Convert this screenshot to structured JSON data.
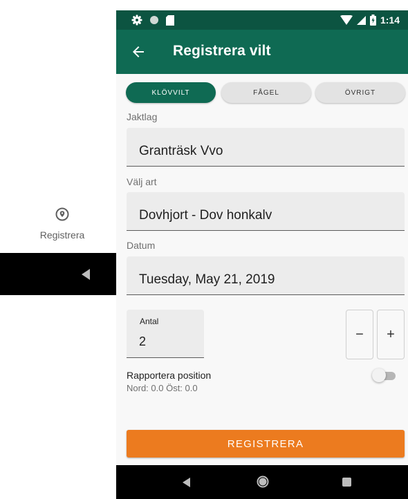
{
  "background_app": {
    "nav_label": "Registrera",
    "nav_icon": "location-pin-icon"
  },
  "status_bar": {
    "time": "1:14",
    "icons_left": [
      "settings-icon",
      "circle-icon",
      "sd-card-icon"
    ],
    "icons_right": [
      "wifi-icon",
      "signal-icon",
      "battery-icon"
    ]
  },
  "app_bar": {
    "title": "Registrera vilt",
    "back_icon": "arrow-left-icon"
  },
  "segments": [
    {
      "label": "KLÖVVILT",
      "active": true
    },
    {
      "label": "FÅGEL",
      "active": false
    },
    {
      "label": "ÖVRIGT",
      "active": false
    }
  ],
  "fields": {
    "jaktlag": {
      "label": "Jaktlag",
      "value": "Granträsk Vvo"
    },
    "art": {
      "label": "Välj art",
      "value": "Dovhjort - Dov honkalv"
    },
    "datum": {
      "label": "Datum",
      "value": "Tuesday, May 21, 2019"
    }
  },
  "antal": {
    "label": "Antal",
    "value": "2",
    "minus_label": "−",
    "plus_label": "+"
  },
  "position": {
    "label": "Rapportera position",
    "coords": "Nord: 0.0 Öst: 0.0",
    "toggle_on": false
  },
  "register_button": {
    "label": "REGISTRERA"
  },
  "colors": {
    "primary": "#0f6a53",
    "primary_dark": "#0c5441",
    "accent": "#ec7b1f"
  }
}
